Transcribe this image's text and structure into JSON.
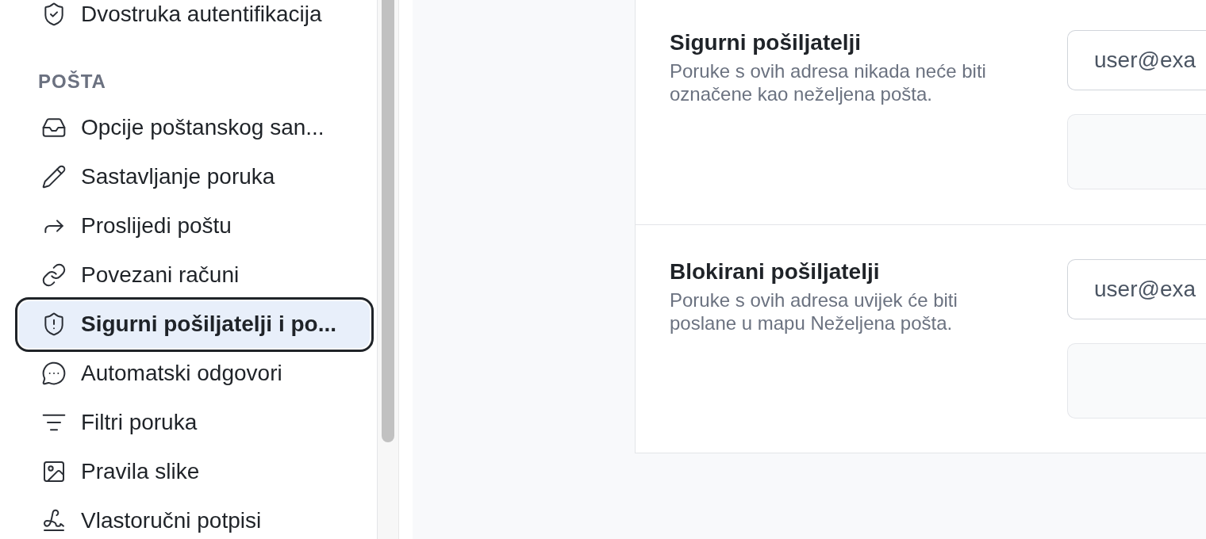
{
  "sidebar": {
    "items": [
      {
        "label": "Dvostruka autentifikacija",
        "selected": false
      }
    ],
    "sections": [
      {
        "heading": "POŠTA",
        "items": [
          {
            "label": "Opcije poštanskog san...",
            "selected": false
          },
          {
            "label": "Sastavljanje poruka",
            "selected": false
          },
          {
            "label": "Proslijedi poštu",
            "selected": false
          },
          {
            "label": "Povezani računi",
            "selected": false
          },
          {
            "label": "Sigurni pošiljatelji i po...",
            "selected": true
          },
          {
            "label": "Automatski odgovori",
            "selected": false
          },
          {
            "label": "Filtri poruka",
            "selected": false
          },
          {
            "label": "Pravila slike",
            "selected": false
          },
          {
            "label": "Vlastoručni potpisi",
            "selected": false
          }
        ]
      }
    ]
  },
  "settings_card": {
    "sections": [
      {
        "title": "Sigurni pošiljatelji",
        "description": "Poruke s ovih adresa nikada neće biti označene kao neželjena pošta.",
        "email_input": {
          "placeholder": "user@exa"
        }
      },
      {
        "title": "Blokirani pošiljatelji",
        "description": "Poruke s ovih adresa uvijek će biti poslane u mapu Neželjena pošta.",
        "email_input": {
          "placeholder": "user@exa"
        }
      }
    ]
  }
}
